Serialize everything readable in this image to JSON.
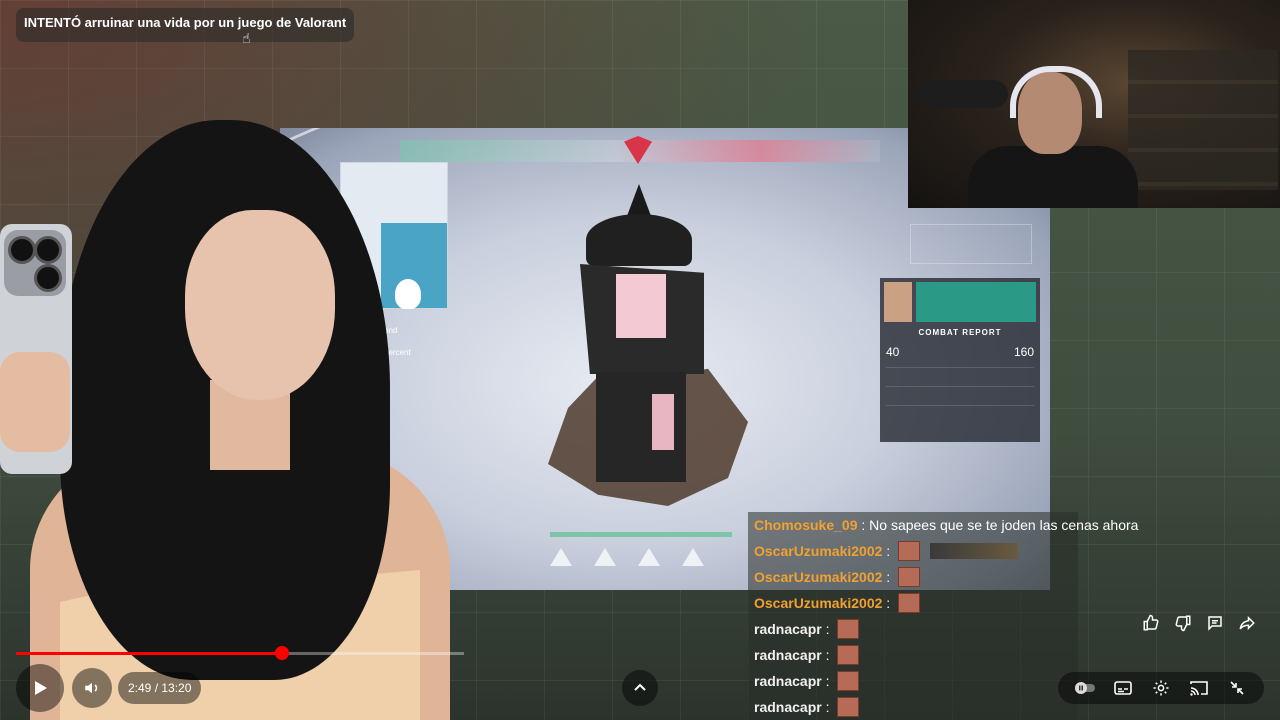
{
  "video": {
    "title": "INTENTÓ arruinar una vida por un juego de Valorant",
    "time_display": "2:49 / 13:20",
    "progress_fraction": 0.593
  },
  "game_hud": {
    "combat_report_title": "COMBAT REPORT",
    "left_score": "40",
    "right_score": "160",
    "minimap_text_1": "and",
    "minimap_text_2": "percent"
  },
  "chat": {
    "messages": [
      {
        "user": "Chomosuke_09",
        "separator": " : ",
        "text": "No sapees que se te joden las cenas ahora",
        "user_color": "orange",
        "content": "text"
      },
      {
        "user": "OscarUzumaki2002",
        "separator": " : ",
        "text": "",
        "user_color": "orange",
        "content": "emote+badge"
      },
      {
        "user": "OscarUzumaki2002",
        "separator": " : ",
        "text": "",
        "user_color": "orange",
        "content": "emote"
      },
      {
        "user": "OscarUzumaki2002",
        "separator": " : ",
        "text": "",
        "user_color": "orange",
        "content": "emote"
      },
      {
        "user": "radnacapr",
        "separator": " : ",
        "text": "",
        "user_color": "white",
        "content": "emote"
      },
      {
        "user": "radnacapr",
        "separator": " : ",
        "text": "",
        "user_color": "white",
        "content": "emote"
      },
      {
        "user": "radnacapr",
        "separator": " : ",
        "text": "",
        "user_color": "white",
        "content": "emote"
      },
      {
        "user": "radnacapr",
        "separator": " : ",
        "text": "",
        "user_color": "white",
        "content": "emote"
      }
    ]
  },
  "colors": {
    "progress": "#ff0000",
    "chat_user_orange": "#f0a130"
  },
  "icons": {
    "play": "play-icon",
    "volume": "volume-icon",
    "expand": "chevron-up-icon",
    "autoplay": "autoplay-toggle-icon",
    "subtitles": "subtitles-icon",
    "settings": "gear-icon",
    "cast": "cast-icon",
    "exit_fullscreen": "exit-fullscreen-icon",
    "like": "thumbs-up-icon",
    "dislike": "thumbs-down-icon",
    "comment": "comment-icon",
    "share": "share-icon"
  }
}
